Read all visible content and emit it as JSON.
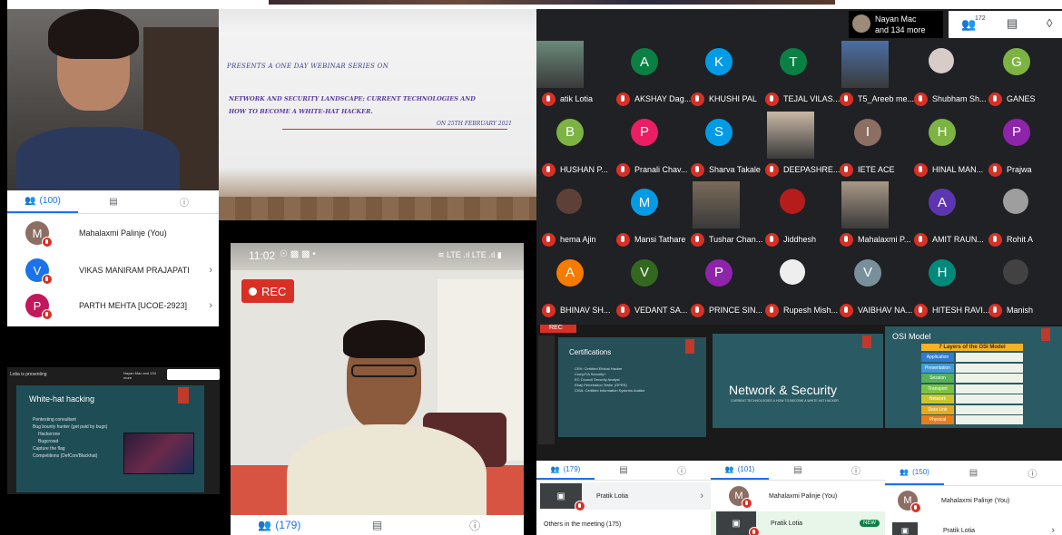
{
  "webinar_slide": {
    "presents": "PRESENTS A ONE DAY WEBINAR SERIES ON",
    "title_line1": "NETWORK AND SECURITY LANDSCAPE: CURRENT TECHNOLOGIES AND",
    "title_line2": "HOW TO BECOME A WHITE-HAT HACKER.",
    "date": "ON 25TH FEBRUARY 2021"
  },
  "panel_top_left": {
    "tab_people_count": "(100)",
    "participants": [
      {
        "initial": "M",
        "name": "Mahalaxmi Palinje (You)",
        "color": "#8d6e63"
      },
      {
        "initial": "V",
        "name": "VIKAS MANIRAM PRAJAPATI",
        "color": "#1a73e8"
      },
      {
        "initial": "P",
        "name": "PARTH MEHTA [UCOE-2923]",
        "color": "#c2185b"
      }
    ]
  },
  "presenting_tile": {
    "presenter_label": "Lotia is presenting",
    "meeting_info": "Nayan Mac and 134 more",
    "slide_title": "White-hat hacking",
    "bullets": [
      "Pentesting consultant",
      "Bug bounty hunter (get paid by bugs)",
      "Hackerone",
      "Bugcrowd",
      "Capture the flag",
      "Competitions (DefCon/Blackhat)"
    ]
  },
  "phone_status": {
    "time": "11:02",
    "rec_label": "REC"
  },
  "bottom_center_tabs": {
    "people_count": "(179)"
  },
  "meet_header": {
    "host_line1": "Nayan Mac",
    "host_line2": "and 134 more",
    "people_count": "172"
  },
  "grid": [
    {
      "name": "atik Lotia",
      "initial": "",
      "photo": true,
      "photo_color": "#6a8a7a"
    },
    {
      "name": "AKSHAY Dag...",
      "initial": "A",
      "color": "#0b8043"
    },
    {
      "name": "KHUSHI PAL",
      "initial": "K",
      "color": "#039be5"
    },
    {
      "name": "TEJAL VILAS...",
      "initial": "T",
      "color": "#0b8043"
    },
    {
      "name": "T5_Areeb me...",
      "initial": "",
      "photo": true,
      "photo_color": "#4a6fa5"
    },
    {
      "name": "Shubham Sh...",
      "initial": "",
      "small_photo": true,
      "color": "#d7ccc8"
    },
    {
      "name": "GANES",
      "initial": "G",
      "color": "#7cb342"
    },
    {
      "name": "HUSHAN P...",
      "initial": "B",
      "color": "#7cb342"
    },
    {
      "name": "Pranali Chav...",
      "initial": "P",
      "color": "#e91e63"
    },
    {
      "name": "Sharva Takale",
      "initial": "S",
      "color": "#039be5"
    },
    {
      "name": "DEEPASHRE...",
      "initial": "",
      "photo": true,
      "photo_color": "#c9b8a6"
    },
    {
      "name": "IETE ACE",
      "initial": "I",
      "color": "#8d6e63"
    },
    {
      "name": "HINAL MAN...",
      "initial": "H",
      "color": "#7cb342"
    },
    {
      "name": "Prajwa",
      "initial": "P",
      "color": "#8e24aa"
    },
    {
      "name": "hema Ajin",
      "initial": "",
      "small_photo": true,
      "color": "#5d4037"
    },
    {
      "name": "Mansi Tathare",
      "initial": "M",
      "color": "#039be5"
    },
    {
      "name": "Tushar Chan...",
      "initial": "",
      "photo": true,
      "photo_color": "#7a6a5a"
    },
    {
      "name": "Jiddhesh",
      "initial": "",
      "small_photo": true,
      "color": "#b71c1c"
    },
    {
      "name": "Mahalaxmi P...",
      "initial": "",
      "photo": true,
      "photo_color": "#a89886"
    },
    {
      "name": "AMIT RAUN...",
      "initial": "A",
      "color": "#5e35b1"
    },
    {
      "name": "Rohit A",
      "initial": "",
      "small_photo": true,
      "color": "#9e9e9e"
    },
    {
      "name": "BHINAV SH...",
      "initial": "A",
      "color": "#f57c00"
    },
    {
      "name": "VEDANT SA...",
      "initial": "V",
      "color": "#33691e"
    },
    {
      "name": "PRINCE SIN...",
      "initial": "P",
      "color": "#8e24aa"
    },
    {
      "name": "Rupesh Mish...",
      "initial": "",
      "small_photo": true,
      "color": "#eeeeee"
    },
    {
      "name": "VAIBHAV NA...",
      "initial": "V",
      "color": "#78909c"
    },
    {
      "name": "HITESH RAVI...",
      "initial": "H",
      "color": "#00897b"
    },
    {
      "name": "Manish",
      "initial": "",
      "small_photo": true,
      "color": "#424242"
    }
  ],
  "ppt_slide": {
    "rec": "REC",
    "title": "Certifications",
    "bullets": [
      "CEH: Certified Ethical Hacker",
      "CompTIA Security+",
      "EC Council Security Analyst",
      "Ebay Penetration Tester (GPEN)",
      "CISA: Certified Information Systems Auditor"
    ]
  },
  "network_slide": {
    "title": "Network & Security",
    "subtitle": "CURRENT TECHNOLOGIES & HOW TO BECOME A WHITE HAT HACKER"
  },
  "osi_slide": {
    "title": "OSI Model",
    "header": "7 Layers of the OSI Model",
    "layers": [
      {
        "name": "Application",
        "color": "#2e7bcf"
      },
      {
        "name": "Presentation",
        "color": "#3f9ad8"
      },
      {
        "name": "Session",
        "color": "#58b158"
      },
      {
        "name": "Transport",
        "color": "#7cc242"
      },
      {
        "name": "Network",
        "color": "#c8c52e"
      },
      {
        "name": "Data Link",
        "color": "#e8a91c"
      },
      {
        "name": "Physical",
        "color": "#e87d1c"
      }
    ]
  },
  "panel_b1": {
    "people_count": "(179)",
    "row1": "Pratik Lotia",
    "section": "Others in the meeting (175)"
  },
  "panel_b2": {
    "people_count": "(101)",
    "row1": "Mahalaxmi Palinje (You)",
    "row2": "Pratik Lotia",
    "badge": "NEW"
  },
  "panel_b3": {
    "people_count": "(150)",
    "row1": "Mahalaxmi Palinje (You)",
    "row2": "Pratik Lotia"
  }
}
